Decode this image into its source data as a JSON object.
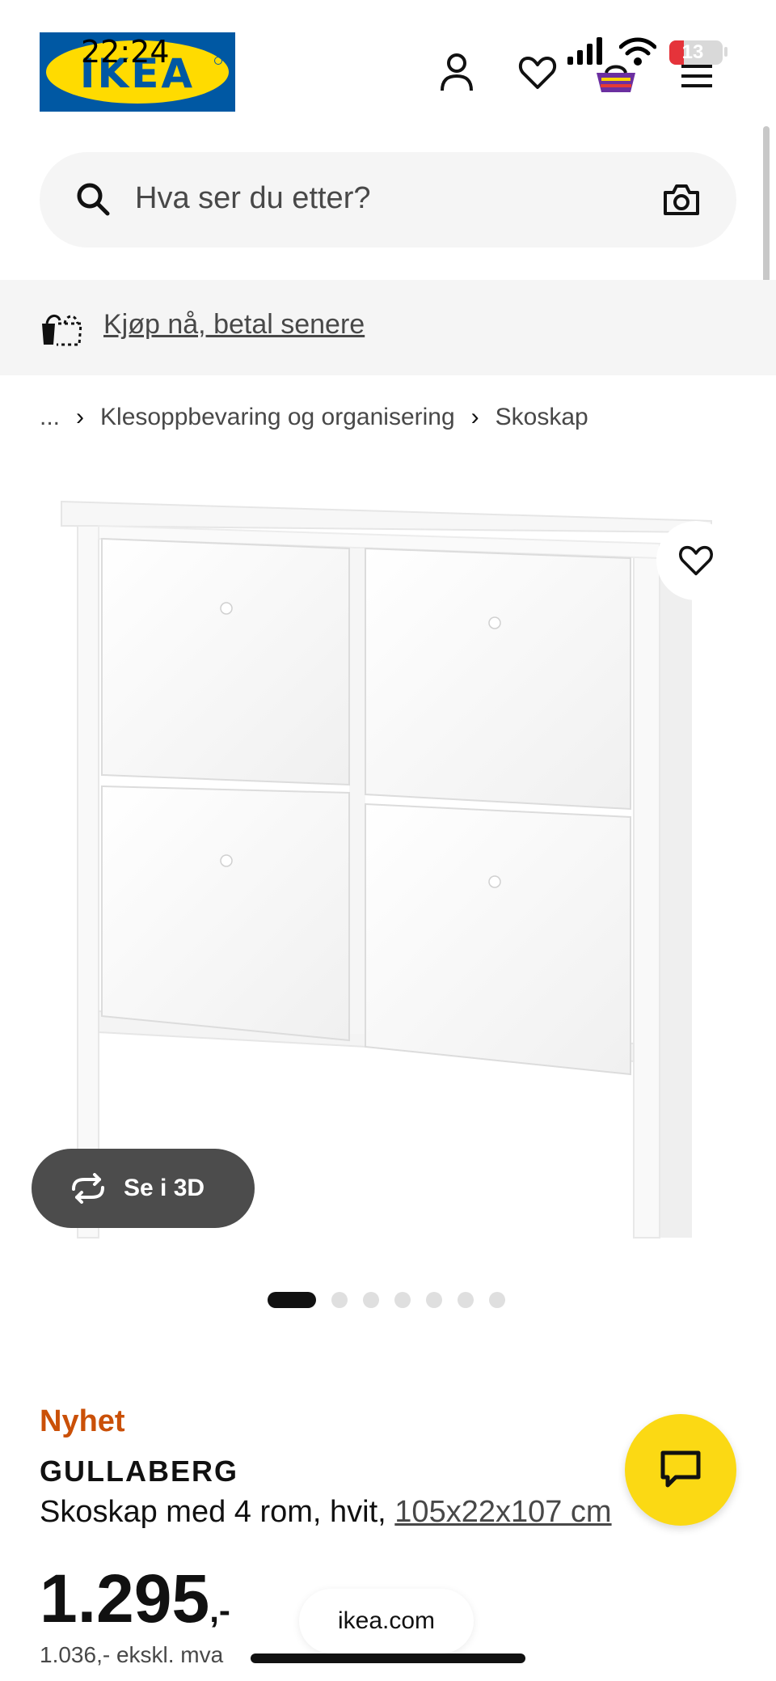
{
  "status_bar": {
    "time": "22:24",
    "battery": "13"
  },
  "header": {
    "logo": "IKEA"
  },
  "search": {
    "placeholder": "Hva ser du etter?"
  },
  "banner": {
    "text": "Kjøp nå, betal senere"
  },
  "breadcrumb": {
    "items": [
      "...",
      "Klesoppbevaring og organisering",
      "Skoskap"
    ]
  },
  "gallery": {
    "view_3d_label": "Se i 3D",
    "dot_count": 7,
    "active_index": 0
  },
  "product": {
    "tag": "Nyhet",
    "name": "GULLABERG",
    "description": "Skoskap med 4 rom, hvit, ",
    "dimensions": "105x22x107 cm",
    "price": "1.295",
    "price_suffix": ",-",
    "price_ex_vat": "1.036,- ekskl. mva"
  },
  "browser": {
    "url": "ikea.com"
  },
  "colors": {
    "accent_yellow": "#fbd914",
    "new_tag": "#ca5008",
    "ikea_blue": "#0058a3",
    "ikea_yellow": "#ffdb00"
  },
  "icons": [
    "profile-icon",
    "heart-icon",
    "cart-icon",
    "menu-icon",
    "search-icon",
    "camera-icon",
    "pay-later-icon",
    "rotate-3d-icon",
    "chat-icon"
  ]
}
